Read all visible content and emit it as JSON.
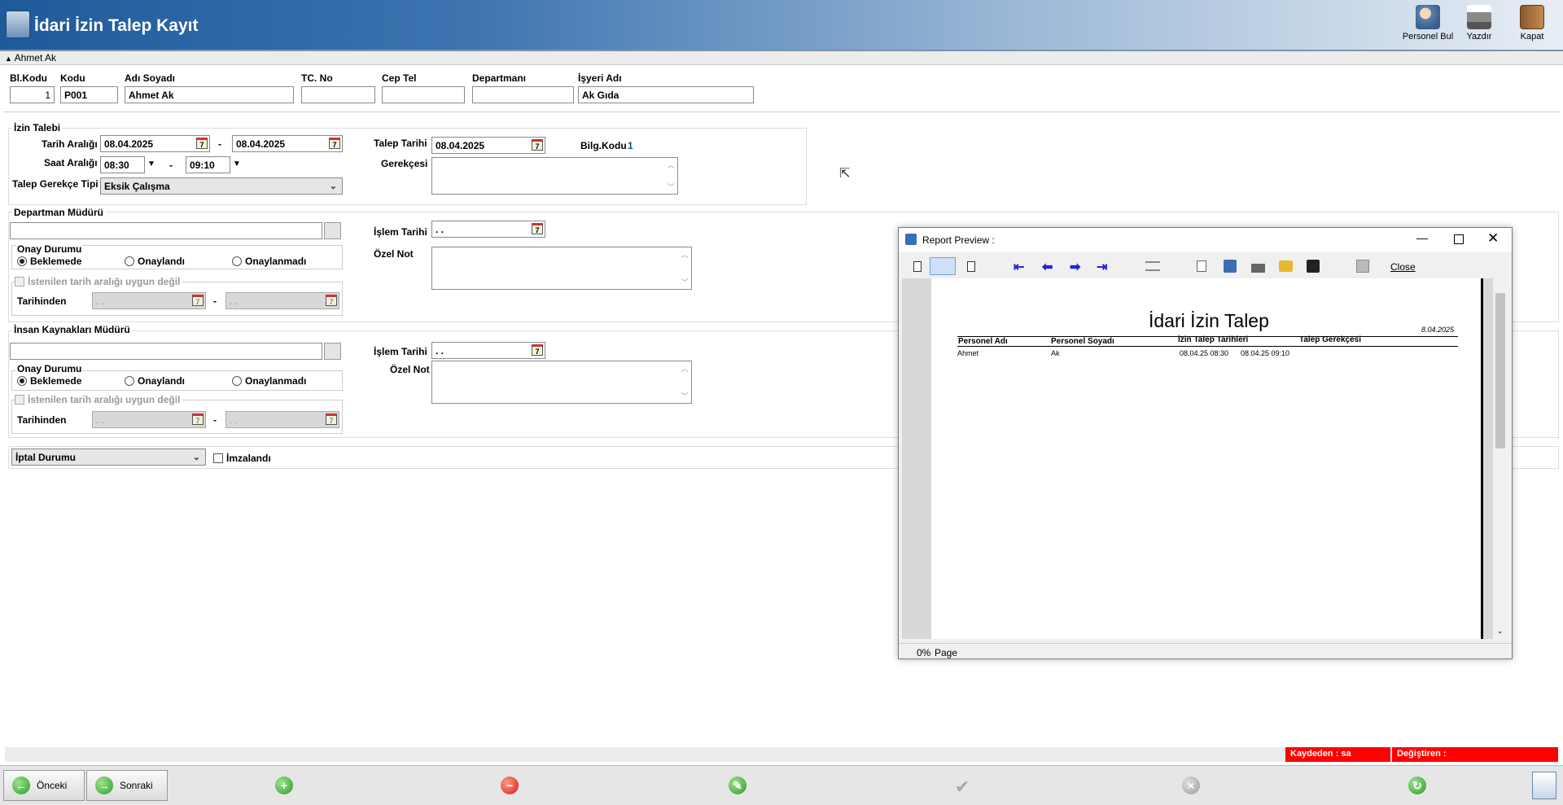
{
  "header": {
    "title": "İdari İzin Talep Kayıt",
    "buttons": [
      {
        "label": "Personel Bul",
        "icon": "person-search-icon"
      },
      {
        "label": "Yazdır",
        "icon": "printer-icon"
      },
      {
        "label": "Kapat",
        "icon": "close-door-icon"
      }
    ]
  },
  "collapse_bar": {
    "label": "Ahmet Ak"
  },
  "employee": {
    "headers": {
      "blkodu": "Bl.Kodu",
      "kodu": "Kodu",
      "adi": "Adı Soyadı",
      "tc": "TC. No",
      "cep": "Cep Tel",
      "dept": "Departmanı",
      "isyeri": "İşyeri Adı"
    },
    "values": {
      "blkodu": "1",
      "kodu": "P001",
      "adi": "Ahmet Ak",
      "tc": "",
      "cep": "",
      "dept": "",
      "isyeri": "Ak Gıda"
    }
  },
  "izin_talebi": {
    "section_title": "İzin Talebi",
    "tarih_label": "Tarih Aralığı",
    "tarih_from": "08.04.2025",
    "tarih_to": "08.04.2025",
    "dash": "-",
    "saat_label": "Saat Aralığı",
    "saat_from": "08:30",
    "saat_to": "09:10",
    "gerekce_tipi_label": "Talep Gerekçe Tipi",
    "gerekce_tipi_value": "Eksik Çalışma",
    "talep_tarihi_label": "Talep Tarihi",
    "talep_tarihi_value": "08.04.2025",
    "bilg_kodu_label": "Bilg.Kodu",
    "bilg_kodu_value": "1",
    "gerekcesi_label": "Gerekçesi"
  },
  "dept_mudur": {
    "section_title": "Departman Müdürü",
    "islem_tarihi_label": "İşlem Tarihi",
    "islem_tarihi_value": ". .",
    "ozel_not_label": "Özel Not",
    "onay_label": "Onay Durumu",
    "radios": [
      "Beklemede",
      "Onaylandı",
      "Onaylanmadı"
    ],
    "uygun_label": "İstenilen tarih aralığı uygun değil",
    "tarihinden_label": "Tarihinden",
    "tarih_from": ". .",
    "tarih_to": ". ."
  },
  "ik_mudur": {
    "section_title": "İnsan Kaynakları Müdürü",
    "islem_tarihi_label": "İşlem Tarihi",
    "islem_tarihi_value": ". .",
    "ozel_not_label": "Özel Not",
    "onay_label": "Onay Durumu",
    "radios": [
      "Beklemede",
      "Onaylandı",
      "Onaylanmadı"
    ],
    "uygun_label": "İstenilen tarih aralığı uygun değil",
    "tarihinden_label": "Tarihinden",
    "tarih_from": ". .",
    "tarih_to": ". ."
  },
  "iptal": {
    "combo_value": "İptal Durumu",
    "imzalandi_label": "İmzalandı"
  },
  "status": {
    "kaydeden": "Kaydeden : sa",
    "degistiren": "Değiştiren :"
  },
  "footer": {
    "prev": "Önceki",
    "next": "Sonraki"
  },
  "report_preview": {
    "title": "Report Preview :",
    "close_label": "Close",
    "report_title": "İdari İzin Talep",
    "date": "8.04.2025",
    "columns": [
      "Personel Adı",
      "Personel Soyadı",
      "İzin Talep Tarihleri",
      "Talep Gerekçesi"
    ],
    "row": {
      "ad": "Ahmet",
      "soyad": "Ak",
      "tarih1": "08.04.25 08:30",
      "tarih2": "08.04.25 09:10"
    },
    "status_zoom": "0%",
    "status_page": "Page"
  },
  "colors": {
    "header_start": "#1b4f8c",
    "status_red": "#ff0000"
  }
}
